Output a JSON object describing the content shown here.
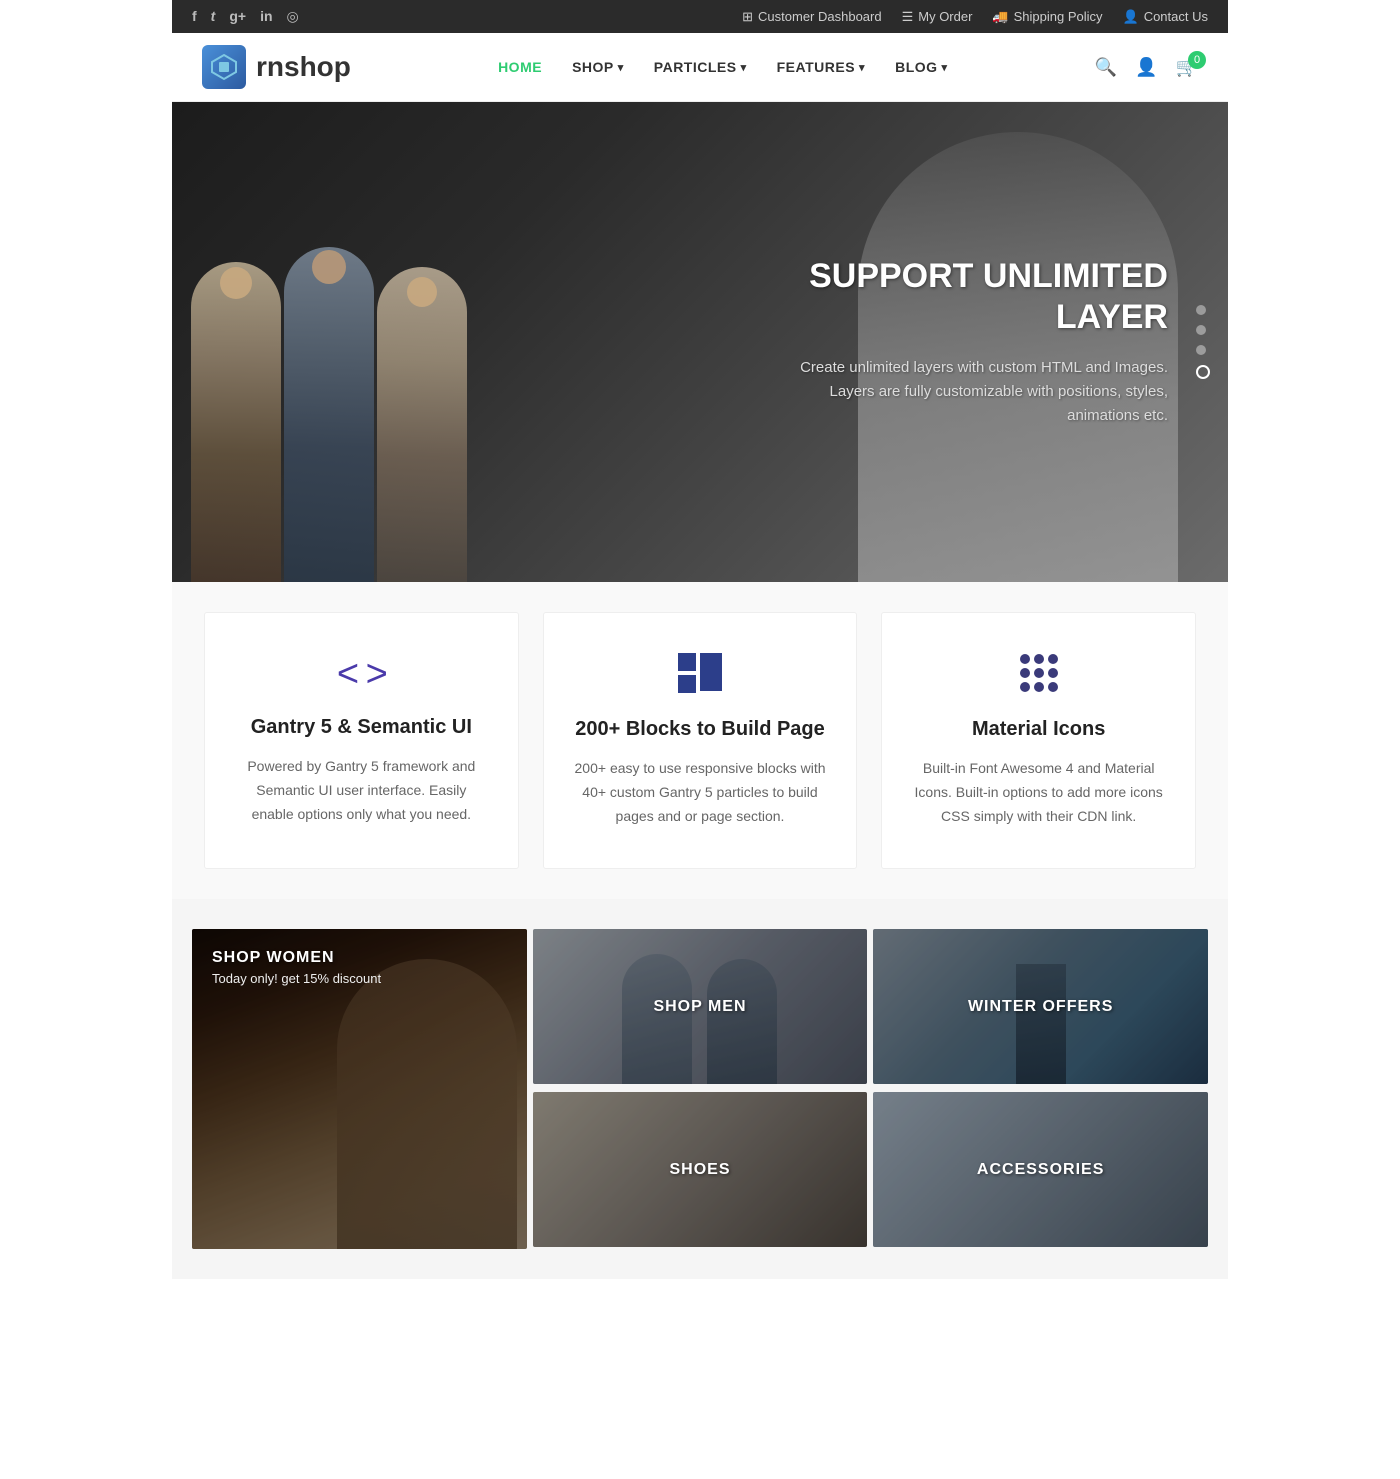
{
  "topbar": {
    "social": [
      {
        "name": "facebook",
        "icon": "f"
      },
      {
        "name": "twitter",
        "icon": "t"
      },
      {
        "name": "google-plus",
        "icon": "g+"
      },
      {
        "name": "linkedin",
        "icon": "in"
      },
      {
        "name": "instagram",
        "icon": "📷"
      }
    ],
    "links": [
      {
        "label": "Customer Dashboard",
        "icon": "⊞"
      },
      {
        "label": "My Order",
        "icon": "☰"
      },
      {
        "label": "Shipping Policy",
        "icon": "🚚"
      },
      {
        "label": "Contact Us",
        "icon": "👤"
      }
    ]
  },
  "nav": {
    "logo_text": "rnshop",
    "links": [
      {
        "label": "HOME",
        "active": true
      },
      {
        "label": "SHOP",
        "hasDropdown": true
      },
      {
        "label": "PARTICLES",
        "hasDropdown": true
      },
      {
        "label": "FEATURES",
        "hasDropdown": true
      },
      {
        "label": "BLOG",
        "hasDropdown": true
      }
    ],
    "cart_count": "0"
  },
  "hero": {
    "title": "SUPPORT UNLIMITED LAYER",
    "description_line1": "Create unlimited layers with custom HTML and Images.",
    "description_line2": "Layers are fully customizable with positions, styles, animations etc.",
    "dots": [
      {
        "active": false
      },
      {
        "active": false
      },
      {
        "active": false
      },
      {
        "active": true
      }
    ]
  },
  "features": [
    {
      "icon_type": "code",
      "title": "Gantry 5 & Semantic UI",
      "description": "Powered by Gantry 5 framework and Semantic UI user interface. Easily enable options only what you need."
    },
    {
      "icon_type": "grid",
      "title": "200+ Blocks to Build Page",
      "description": "200+ easy to use responsive blocks with 40+ custom Gantry 5 particles to build pages and or page section."
    },
    {
      "icon_type": "dots",
      "title": "Material Icons",
      "description": "Built-in Font Awesome 4 and Material Icons. Built-in options to add more icons CSS simply with their CDN link."
    }
  ],
  "shop": [
    {
      "id": "women",
      "title": "SHOP WOMEN",
      "subtitle": "Today only! get 15% discount",
      "size": "large",
      "bg": "bg-women"
    },
    {
      "id": "men",
      "title": "SHOP MEN",
      "subtitle": "",
      "size": "medium",
      "bg": "bg-men"
    },
    {
      "id": "winter",
      "title": "WINTER OFFERS",
      "subtitle": "",
      "size": "medium",
      "bg": "bg-winter"
    },
    {
      "id": "shoes",
      "title": "SHOES",
      "subtitle": "",
      "size": "medium",
      "bg": "bg-shoes"
    },
    {
      "id": "accessories",
      "title": "ACCESSORIES",
      "subtitle": "",
      "size": "medium",
      "bg": "bg-accessories"
    }
  ]
}
